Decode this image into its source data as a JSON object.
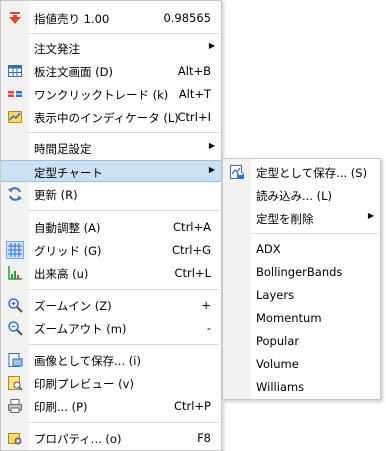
{
  "main_menu": {
    "items": [
      {
        "label": "指値売り 1.00",
        "shortcut": "0.98565",
        "icon": "sell-arrow-icon"
      },
      {
        "label": "注文発注",
        "has_submenu": true
      },
      {
        "label": "板注文画面 (D)",
        "shortcut": "Alt+B",
        "icon": "order-book-icon"
      },
      {
        "label": "ワンクリックトレード (k)",
        "shortcut": "Alt+T",
        "icon": "one-click-trade-icon"
      },
      {
        "label": "表示中のインディケータ (L)",
        "shortcut": "Ctrl+I",
        "icon": "indicators-icon"
      },
      {
        "label": "時間足設定",
        "has_submenu": true
      },
      {
        "label": "定型チャート",
        "has_submenu": true,
        "highlighted": true
      },
      {
        "label": "更新 (R)",
        "icon": "refresh-icon"
      },
      {
        "label": "自動調整 (A)",
        "shortcut": "Ctrl+A"
      },
      {
        "label": "グリッド (G)",
        "shortcut": "Ctrl+G",
        "icon": "grid-icon"
      },
      {
        "label": "出来高 (u)",
        "shortcut": "Ctrl+L",
        "icon": "volume-icon"
      },
      {
        "label": "ズームイン (Z)",
        "shortcut": "+",
        "icon": "zoom-in-icon"
      },
      {
        "label": "ズームアウト (m)",
        "shortcut": "-",
        "icon": "zoom-out-icon"
      },
      {
        "label": "画像として保存... (i)",
        "icon": "save-image-icon"
      },
      {
        "label": "印刷プレビュー (v)",
        "icon": "print-preview-icon"
      },
      {
        "label": "印刷... (P)",
        "shortcut": "Ctrl+P",
        "icon": "print-icon"
      },
      {
        "label": "プロパティ... (o)",
        "shortcut": "F8",
        "icon": "properties-icon"
      }
    ]
  },
  "sub_menu": {
    "items": [
      {
        "label": "定型として保存... (S)",
        "icon": "save-template-icon"
      },
      {
        "label": "読み込み... (L)"
      },
      {
        "label": "定型を削除",
        "has_submenu": true
      },
      {
        "label": "ADX"
      },
      {
        "label": "BollingerBands"
      },
      {
        "label": "Layers"
      },
      {
        "label": "Momentum"
      },
      {
        "label": "Popular"
      },
      {
        "label": "Volume"
      },
      {
        "label": "Williams"
      }
    ]
  },
  "colors": {
    "highlight": "#cce0f4",
    "highlight_border": "#99c1e6",
    "gutter": "#f2f2f2",
    "separator": "#d7d7d7",
    "sell_red": "#e0452c"
  }
}
